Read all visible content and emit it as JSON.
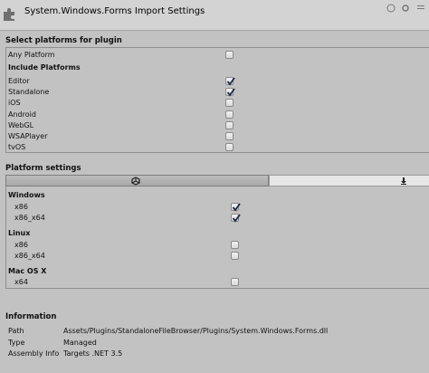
{
  "header": {
    "title": "System.Windows.Forms Import Settings",
    "icons": [
      "puzzle-icon",
      "help-icon",
      "settings-icon",
      "menu-icon"
    ]
  },
  "select_platforms": {
    "title": "Select platforms for plugin",
    "any_platform": {
      "label": "Any Platform",
      "checked": false
    },
    "include_title": "Include Platforms",
    "platforms": [
      {
        "label": "Editor",
        "checked": true
      },
      {
        "label": "Standalone",
        "checked": true
      },
      {
        "label": "iOS",
        "checked": false
      },
      {
        "label": "Android",
        "checked": false
      },
      {
        "label": "WebGL",
        "checked": false
      },
      {
        "label": "WSAPlayer",
        "checked": false
      },
      {
        "label": "tvOS",
        "checked": false
      }
    ]
  },
  "platform_settings": {
    "title": "Platform settings",
    "tabs": [
      {
        "icon": "unity-logo-icon",
        "selected": true
      },
      {
        "icon": "download-icon",
        "selected": false
      }
    ],
    "groups": [
      {
        "title": "Windows",
        "items": [
          {
            "label": "x86",
            "checked": true
          },
          {
            "label": "x86_x64",
            "checked": true
          }
        ]
      },
      {
        "title": "Linux",
        "items": [
          {
            "label": "x86",
            "checked": false
          },
          {
            "label": "x86_x64",
            "checked": false
          }
        ]
      },
      {
        "title": "Mac OS X",
        "items": [
          {
            "label": "x64",
            "checked": false
          }
        ]
      }
    ]
  },
  "information": {
    "title": "Information",
    "rows": [
      {
        "key": "Path",
        "value": "Assets/Plugins/StandaloneFileBrowser/Plugins/System.Windows.Forms.dll"
      },
      {
        "key": "Type",
        "value": "Managed"
      },
      {
        "key": "Assembly Info",
        "value": "Targets .NET 3.5"
      }
    ]
  }
}
